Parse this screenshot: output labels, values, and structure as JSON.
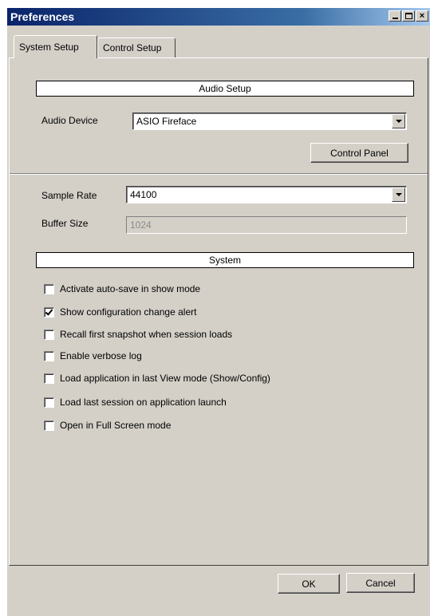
{
  "window": {
    "title": "Preferences",
    "buttons": {
      "minimize": "minimize-icon",
      "maximize": "maximize-icon",
      "close": "×"
    }
  },
  "tabs": [
    {
      "label": "System Setup",
      "active": true
    },
    {
      "label": "Control Setup",
      "active": false
    }
  ],
  "audio_setup": {
    "header": "Audio Setup",
    "device_label": "Audio Device",
    "device_value": "ASIO Fireface",
    "control_panel_button": "Control Panel",
    "sample_rate_label": "Sample Rate",
    "sample_rate_value": "44100",
    "buffer_size_label": "Buffer Size",
    "buffer_size_value": "1024"
  },
  "system": {
    "header": "System",
    "options": [
      {
        "label": "Activate auto-save in show mode",
        "checked": false
      },
      {
        "label": "Show configuration change alert",
        "checked": true
      },
      {
        "label": "Recall first snapshot when session loads",
        "checked": false
      },
      {
        "label": "Enable verbose log",
        "checked": false
      },
      {
        "label": "Load application in last View mode (Show/Config)",
        "checked": false
      },
      {
        "label": "Load last session on application launch",
        "checked": false
      },
      {
        "label": "Open in Full Screen mode",
        "checked": false
      }
    ]
  },
  "footer": {
    "ok_label": "OK",
    "cancel_label": "Cancel"
  }
}
